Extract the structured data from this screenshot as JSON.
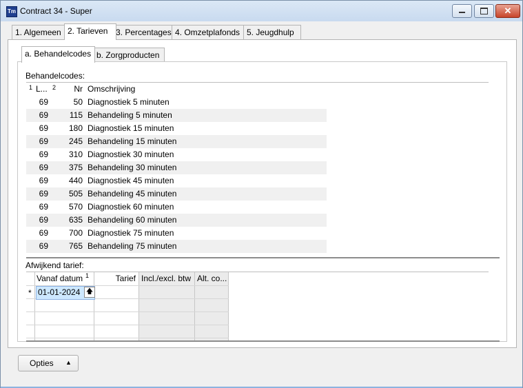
{
  "window": {
    "title": "Contract 34 - Super",
    "app_icon": "Tm",
    "controls": {
      "minimize": "minimize-icon",
      "maximize": "maximize-icon",
      "close": "✕"
    }
  },
  "tabs": [
    {
      "label": "1. Algemeen"
    },
    {
      "label": "2. Tarieven"
    },
    {
      "label": "3. Percentages"
    },
    {
      "label": "4. Omzetplafonds"
    },
    {
      "label": "5. Jeugdhulp"
    }
  ],
  "subtabs": [
    {
      "label": "a. Behandelcodes"
    },
    {
      "label": "b. Zorgproducten"
    }
  ],
  "behandelcodes": {
    "label": "Behandelcodes:",
    "columns": {
      "sort1": "1",
      "col1": "L...",
      "sort2": "2",
      "col2": "Nr",
      "col3": "Omschrijving"
    },
    "rows": [
      {
        "l": "69",
        "nr": "50",
        "omschrijving": "Diagnostiek 5 minuten"
      },
      {
        "l": "69",
        "nr": "115",
        "omschrijving": "Behandeling 5 minuten"
      },
      {
        "l": "69",
        "nr": "180",
        "omschrijving": "Diagnostiek 15 minuten"
      },
      {
        "l": "69",
        "nr": "245",
        "omschrijving": "Behandeling 15 minuten"
      },
      {
        "l": "69",
        "nr": "310",
        "omschrijving": "Diagnostiek 30 minuten"
      },
      {
        "l": "69",
        "nr": "375",
        "omschrijving": "Behandeling 30 minuten"
      },
      {
        "l": "69",
        "nr": "440",
        "omschrijving": "Diagnostiek 45 minuten"
      },
      {
        "l": "69",
        "nr": "505",
        "omschrijving": "Behandeling 45 minuten"
      },
      {
        "l": "69",
        "nr": "570",
        "omschrijving": "Diagnostiek 60 minuten"
      },
      {
        "l": "69",
        "nr": "635",
        "omschrijving": "Behandeling 60 minuten"
      },
      {
        "l": "69",
        "nr": "700",
        "omschrijving": "Diagnostiek 75 minuten"
      },
      {
        "l": "69",
        "nr": "765",
        "omschrijving": "Behandeling 75 minuten"
      }
    ]
  },
  "afwijkend": {
    "label": "Afwijkend tarief:",
    "columns": {
      "vanaf": "Vanaf datum",
      "sort1": "1",
      "tarief": "Tarief",
      "incl": "Incl./excl. btw",
      "alt": "Alt. co..."
    },
    "new_row_marker": "*",
    "new_row": {
      "vanaf": "01-01-2024",
      "up_icon": "🡅"
    }
  },
  "opties": {
    "label": "Opties",
    "arrow": "▲"
  }
}
